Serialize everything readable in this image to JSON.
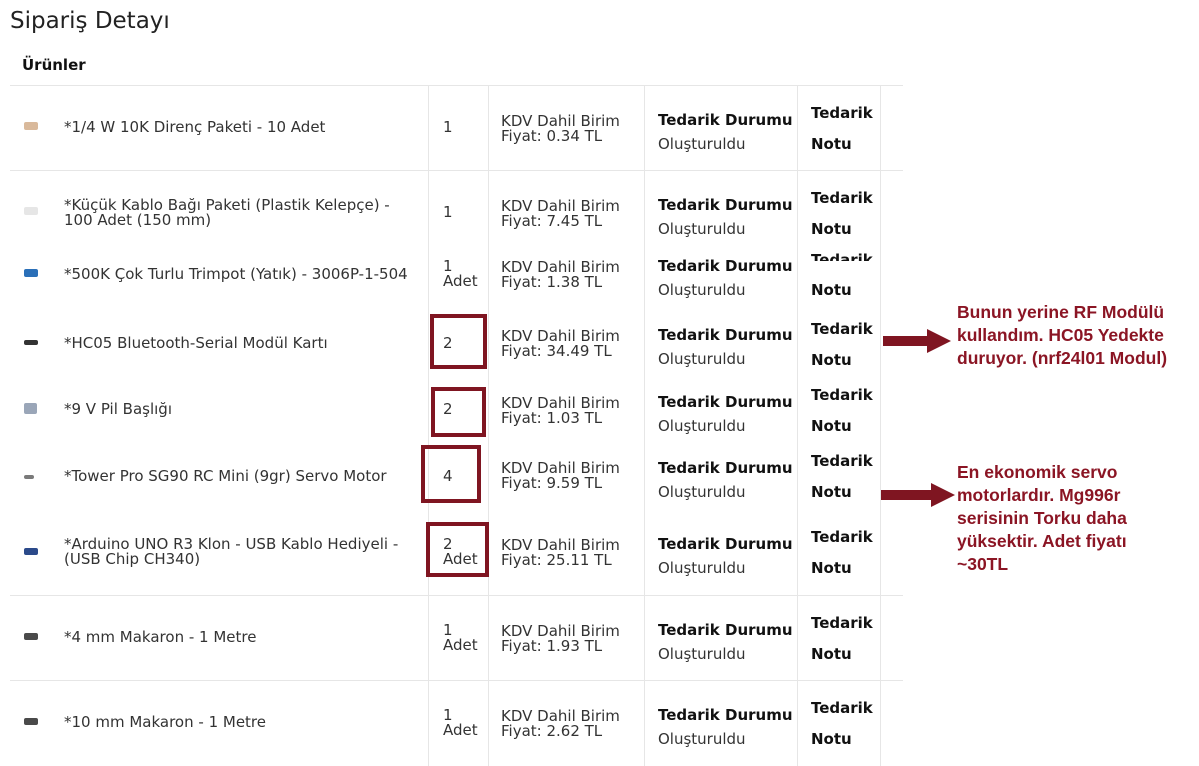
{
  "page": {
    "title": "Sipariş Detayı",
    "section": "Ürünler"
  },
  "columns": {
    "status_title": "Tedarik Durumu",
    "status_value": "Oluşturuldu",
    "note_line1": "Tedarik",
    "note_line2": "Notu"
  },
  "rows": [
    {
      "name": "*1/4 W 10K Direnç Paketi - 10 Adet",
      "qty": "1",
      "price_l1": "KDV Dahil Birim",
      "price_l2": "Fiyat: 0.34 TL",
      "thumb_color": "#d9b99b"
    },
    {
      "name": "*Küçük Kablo Bağı Paketi (Plastik Kelepçe) - 100 Adet (150 mm)",
      "qty": "1",
      "price_l1": "KDV Dahil Birim",
      "price_l2": "Fiyat: 7.45 TL",
      "thumb_color": "#e6e6e6"
    },
    {
      "name": "*500K Çok Turlu Trimpot (Yatık) - 3006P-1-504",
      "qty": "1 Adet",
      "price_l1": "KDV Dahil Birim",
      "price_l2": "Fiyat: 1.38 TL",
      "thumb_color": "#2a6fb8"
    },
    {
      "name": "*HC05 Bluetooth-Serial Modül Kartı",
      "qty": "2",
      "price_l1": "KDV Dahil Birim",
      "price_l2": "Fiyat: 34.49 TL",
      "thumb_color": "#333333"
    },
    {
      "name": "*9 V Pil Başlığı",
      "qty": "2",
      "price_l1": "KDV Dahil Birim",
      "price_l2": "Fiyat: 1.03 TL",
      "thumb_color": "#9aa6b8"
    },
    {
      "name": "*Tower Pro SG90 RC Mini (9gr) Servo Motor",
      "qty": "4",
      "price_l1": "KDV Dahil Birim",
      "price_l2": "Fiyat: 9.59 TL",
      "thumb_color": "#7a7a7a"
    },
    {
      "name": "*Arduino UNO R3 Klon - USB Kablo Hediyeli - (USB Chip CH340)",
      "qty": "2 Adet",
      "price_l1": "KDV Dahil Birim",
      "price_l2": "Fiyat: 25.11 TL",
      "thumb_color": "#2b4a8a"
    },
    {
      "name": "*4 mm Makaron - 1 Metre",
      "qty": "1 Adet",
      "price_l1": "KDV Dahil Birim",
      "price_l2": "Fiyat: 1.93 TL",
      "thumb_color": "#4a4a4a"
    },
    {
      "name": "*10 mm Makaron - 1 Metre",
      "qty": "1 Adet",
      "price_l1": "KDV Dahil Birim",
      "price_l2": "Fiyat: 2.62 TL",
      "thumb_color": "#4a4a4a"
    }
  ],
  "annotations": {
    "hc05_note": [
      "Bunun yerine RF Modülü",
      "kullandım. HC05 Yedekte",
      "duruyor.  (nrf24l01 Modul)"
    ],
    "servo_note": [
      "En ekonomik servo",
      "motorlardır. Mg996r",
      "serisinin Torku daha",
      "yüksektir. Adet fiyatı",
      "~30TL"
    ]
  },
  "colors": {
    "annotation": "#8b1524",
    "box": "#7f1521"
  }
}
